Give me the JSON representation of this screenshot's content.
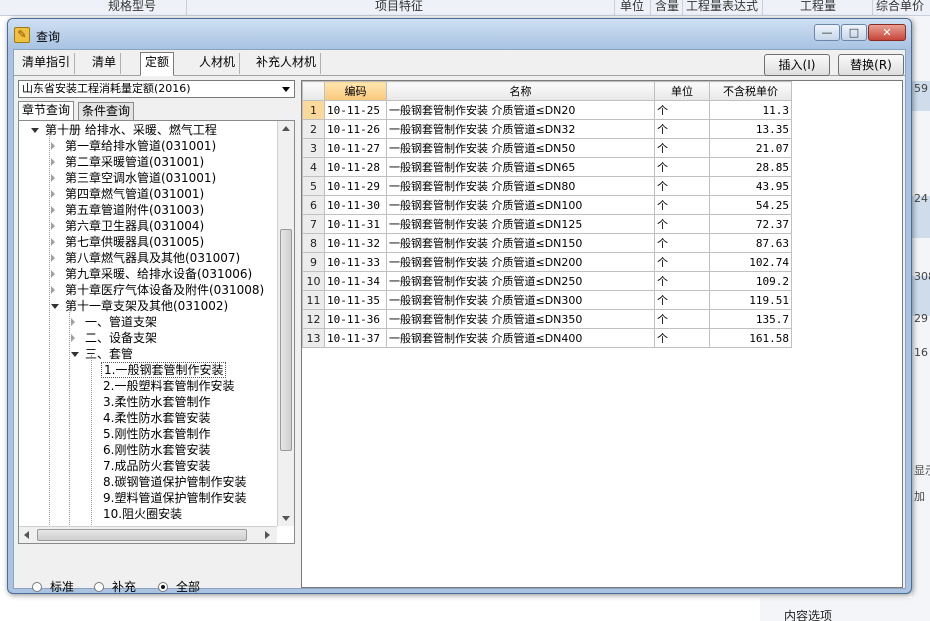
{
  "background": {
    "header_cols": [
      "规格型号",
      "项目特征",
      "单位",
      "含量",
      "工程量表达式",
      "工程量",
      "综合单价"
    ],
    "right_edge": [
      "59",
      "24",
      "308",
      "29",
      "16",
      "显示",
      "加"
    ],
    "bottom_text": "内容选项"
  },
  "dialog": {
    "title": "查询",
    "win_buttons": [
      "—",
      "□",
      "✕"
    ],
    "tabs": [
      "清单指引",
      "清单",
      "定额",
      "人材机",
      "补充人材机"
    ],
    "insert_button": "插入(I)",
    "replace_button": "替换(R)",
    "quota_combo": "山东省安装工程消耗量定额(2016)",
    "sub_tabs": [
      "章节查询",
      "条件查询"
    ],
    "tree": [
      {
        "label": "第十册 给排水、采暖、燃气工程",
        "level": 0,
        "state": "open"
      },
      {
        "label": "第一章给排水管道(031001)",
        "level": 1,
        "state": "closed"
      },
      {
        "label": "第二章采暖管道(031001)",
        "level": 1,
        "state": "closed"
      },
      {
        "label": "第三章空调水管道(031001)",
        "level": 1,
        "state": "closed"
      },
      {
        "label": "第四章燃气管道(031001)",
        "level": 1,
        "state": "closed"
      },
      {
        "label": "第五章管道附件(031003)",
        "level": 1,
        "state": "closed"
      },
      {
        "label": "第六章卫生器具(031004)",
        "level": 1,
        "state": "closed"
      },
      {
        "label": "第七章供暖器具(031005)",
        "level": 1,
        "state": "closed"
      },
      {
        "label": "第八章燃气器具及其他(031007)",
        "level": 1,
        "state": "closed"
      },
      {
        "label": "第九章采暖、给排水设备(031006)",
        "level": 1,
        "state": "closed"
      },
      {
        "label": "第十章医疗气体设备及附件(031008)",
        "level": 1,
        "state": "closed"
      },
      {
        "label": "第十一章支架及其他(031002)",
        "level": 1,
        "state": "open"
      },
      {
        "label": "一、管道支架",
        "level": 2,
        "state": "closed"
      },
      {
        "label": "二、设备支架",
        "level": 2,
        "state": "closed"
      },
      {
        "label": "三、套管",
        "level": 2,
        "state": "open"
      },
      {
        "label": "1.一般钢套管制作安装",
        "level": 3,
        "state": "leaf",
        "selected": true
      },
      {
        "label": "2.一般塑料套管制作安装",
        "level": 3,
        "state": "leaf"
      },
      {
        "label": "3.柔性防水套管制作",
        "level": 3,
        "state": "leaf"
      },
      {
        "label": "4.柔性防水套管安装",
        "level": 3,
        "state": "leaf"
      },
      {
        "label": "5.刚性防水套管制作",
        "level": 3,
        "state": "leaf"
      },
      {
        "label": "6.刚性防水套管安装",
        "level": 3,
        "state": "leaf"
      },
      {
        "label": "7.成品防火套管安装",
        "level": 3,
        "state": "leaf"
      },
      {
        "label": "8.碳钢管道保护管制作安装",
        "level": 3,
        "state": "leaf"
      },
      {
        "label": "9.塑料管道保护管制作安装",
        "level": 3,
        "state": "leaf"
      },
      {
        "label": "10.阻火圈安装",
        "level": 3,
        "state": "leaf"
      }
    ],
    "radios": [
      {
        "label": "标准",
        "checked": false
      },
      {
        "label": "补充",
        "checked": false
      },
      {
        "label": "全部",
        "checked": true
      }
    ],
    "grid": {
      "headers": [
        "编码",
        "名称",
        "单位",
        "不含税单价"
      ],
      "rows": [
        [
          "1",
          "10-11-25",
          "一般钢套管制作安装 介质管道≤DN20",
          "个",
          "11.3"
        ],
        [
          "2",
          "10-11-26",
          "一般钢套管制作安装 介质管道≤DN32",
          "个",
          "13.35"
        ],
        [
          "3",
          "10-11-27",
          "一般钢套管制作安装 介质管道≤DN50",
          "个",
          "21.07"
        ],
        [
          "4",
          "10-11-28",
          "一般钢套管制作安装 介质管道≤DN65",
          "个",
          "28.85"
        ],
        [
          "5",
          "10-11-29",
          "一般钢套管制作安装 介质管道≤DN80",
          "个",
          "43.95"
        ],
        [
          "6",
          "10-11-30",
          "一般钢套管制作安装 介质管道≤DN100",
          "个",
          "54.25"
        ],
        [
          "7",
          "10-11-31",
          "一般钢套管制作安装 介质管道≤DN125",
          "个",
          "72.37"
        ],
        [
          "8",
          "10-11-32",
          "一般钢套管制作安装 介质管道≤DN150",
          "个",
          "87.63"
        ],
        [
          "9",
          "10-11-33",
          "一般钢套管制作安装 介质管道≤DN200",
          "个",
          "102.74"
        ],
        [
          "10",
          "10-11-34",
          "一般钢套管制作安装 介质管道≤DN250",
          "个",
          "109.2"
        ],
        [
          "11",
          "10-11-35",
          "一般钢套管制作安装 介质管道≤DN300",
          "个",
          "119.51"
        ],
        [
          "12",
          "10-11-36",
          "一般钢套管制作安装 介质管道≤DN350",
          "个",
          "135.7"
        ],
        [
          "13",
          "10-11-37",
          "一般钢套管制作安装 介质管道≤DN400",
          "个",
          "161.58"
        ]
      ]
    }
  }
}
